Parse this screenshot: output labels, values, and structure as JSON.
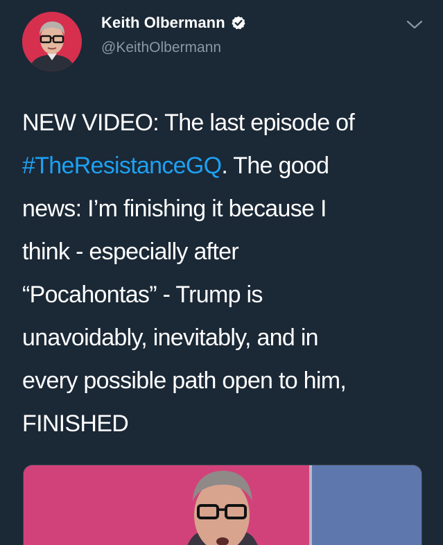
{
  "author": {
    "display_name": "Keith Olbermann",
    "handle": "@KeithOlbermann",
    "verified": true,
    "avatar_icon": "profile-photo"
  },
  "tweet": {
    "lines": [
      {
        "parts": [
          "NEW VIDEO: The last episode of"
        ]
      },
      {
        "hashtag": "#TheResistanceGQ",
        "after": ". The good"
      },
      {
        "parts": [
          "news: I’m finishing it because I"
        ]
      },
      {
        "parts": [
          "think - especially after"
        ]
      },
      {
        "parts": [
          "“Pocahontas” - Trump is"
        ]
      },
      {
        "parts": [
          "unavoidably, inevitably, and in"
        ]
      },
      {
        "parts": [
          "every possible path open to him,"
        ]
      },
      {
        "parts": [
          "FINISHED"
        ]
      }
    ]
  },
  "icons": {
    "verified": "verified-badge-icon",
    "menu": "chevron-down-icon"
  },
  "colors": {
    "background": "#1b2836",
    "link": "#1da1f2",
    "secondary_text": "#8899a6",
    "video_bg": "#d43e74"
  }
}
